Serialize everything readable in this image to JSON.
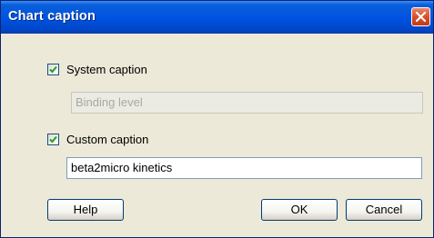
{
  "window": {
    "title": "Chart caption"
  },
  "system_caption": {
    "label": "System caption",
    "checked": true,
    "value": "Binding level"
  },
  "custom_caption": {
    "label": "Custom caption",
    "checked": true,
    "value": "beta2micro kinetics"
  },
  "buttons": {
    "help": "Help",
    "ok": "OK",
    "cancel": "Cancel"
  },
  "colors": {
    "titlebar": "#0054e3",
    "close": "#d8502c",
    "dialog_bg": "#ece9d8",
    "check": "#21a121"
  }
}
